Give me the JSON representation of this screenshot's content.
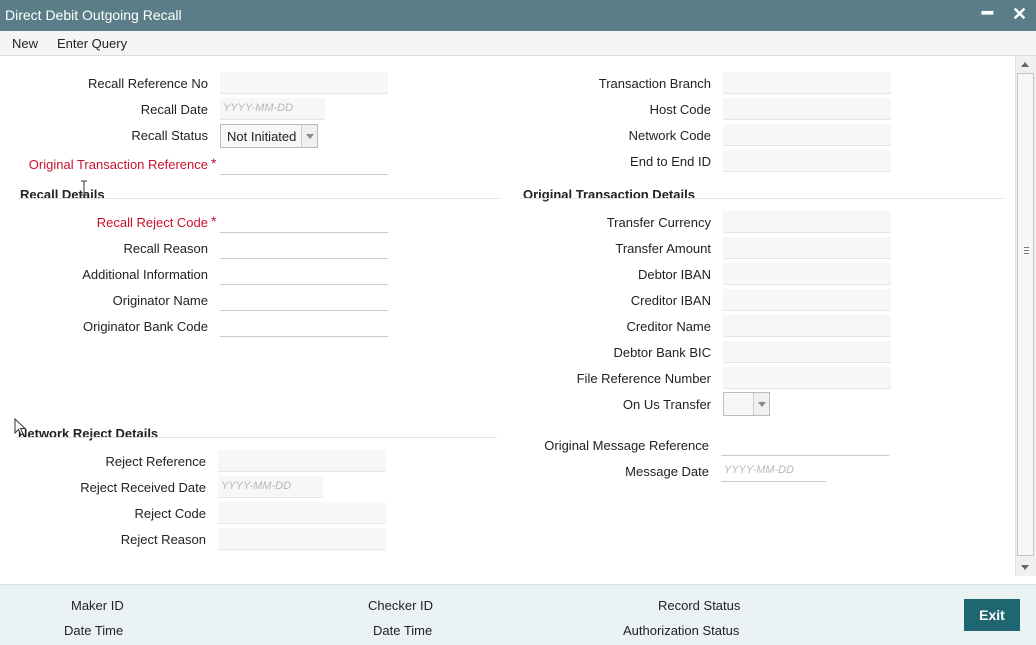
{
  "window": {
    "title": "Direct Debit Outgoing Recall",
    "minimize_glyph": "━",
    "close_glyph": "✕"
  },
  "menu": {
    "new": "New",
    "enter_query": "Enter Query"
  },
  "header_left": {
    "recall_reference_no": "Recall Reference No",
    "recall_date": "Recall Date",
    "recall_date_placeholder": "YYYY-MM-DD",
    "recall_status": "Recall Status",
    "recall_status_value": "Not Initiated",
    "original_transaction_reference": "Original Transaction Reference"
  },
  "header_right": {
    "transaction_branch": "Transaction Branch",
    "host_code": "Host Code",
    "network_code": "Network Code",
    "end_to_end_id": "End to End ID"
  },
  "recall_details": {
    "title": "Recall Details",
    "recall_reject_code": "Recall Reject Code",
    "recall_reason": "Recall Reason",
    "additional_information": "Additional Information",
    "originator_name": "Originator Name",
    "originator_bank_code": "Originator Bank Code"
  },
  "original_transaction_details": {
    "title": "Original Transaction Details",
    "transfer_currency": "Transfer Currency",
    "transfer_amount": "Transfer Amount",
    "debtor_iban": "Debtor IBAN",
    "creditor_iban": "Creditor IBAN",
    "creditor_name": "Creditor Name",
    "debtor_bank_bic": "Debtor Bank BIC",
    "file_reference_number": "File Reference Number",
    "on_us_transfer": "On Us Transfer",
    "original_message_reference": "Original Message Reference",
    "message_date": "Message Date",
    "message_date_placeholder": "YYYY-MM-DD"
  },
  "network_reject_details": {
    "title": "Network Reject Details",
    "reject_reference": "Reject Reference",
    "reject_received_date": "Reject Received Date",
    "reject_received_date_placeholder": "YYYY-MM-DD",
    "reject_code": "Reject Code",
    "reject_reason": "Reject Reason"
  },
  "required_marker": "*",
  "footer": {
    "maker_id": "Maker ID",
    "date_time_1": "Date Time",
    "checker_id": "Checker ID",
    "date_time_2": "Date Time",
    "record_status": "Record Status",
    "authorization_status": "Authorization Status",
    "exit": "Exit"
  },
  "colors": {
    "titlebar": "#5a7d88",
    "required": "#c8102e",
    "footer_bg": "#eaf2f3",
    "exit_button": "#1f6670"
  }
}
